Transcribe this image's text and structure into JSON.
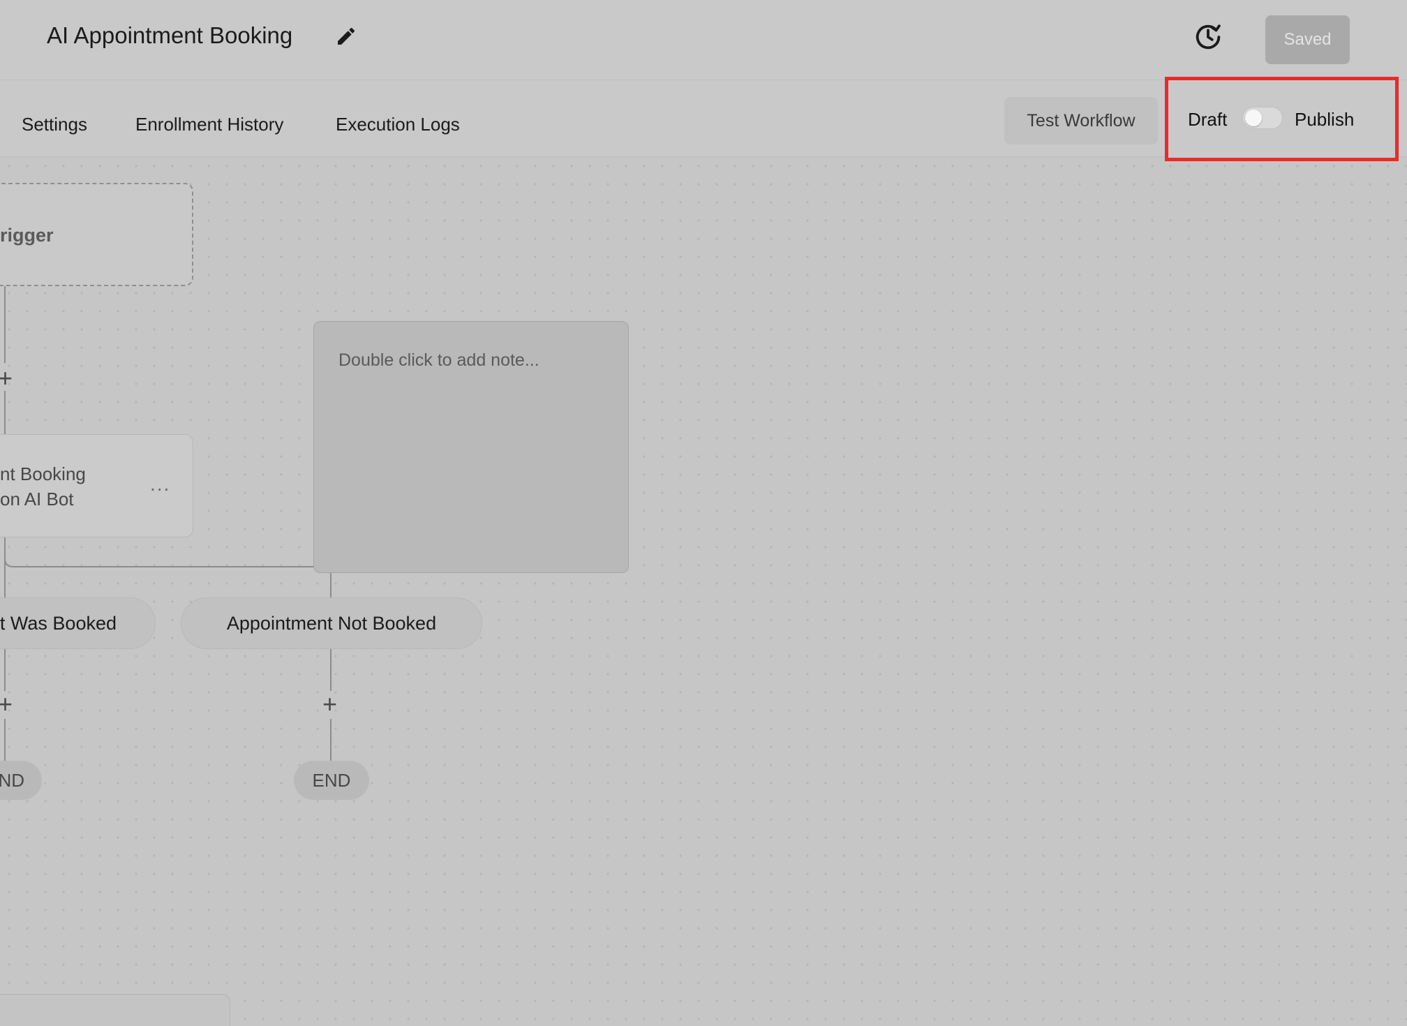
{
  "header": {
    "title": "AI Appointment Booking",
    "saved_label": "Saved"
  },
  "tabs": {
    "settings": "Settings",
    "enrollment_history": "Enrollment History",
    "execution_logs": "Execution Logs"
  },
  "actions": {
    "test_workflow": "Test Workflow",
    "draft_label": "Draft",
    "publish_label": "Publish",
    "publish_toggle_on": false
  },
  "canvas": {
    "trigger_label": "rigger",
    "action_line1": "nt Booking",
    "action_line2": "on AI Bot",
    "action_menu": "...",
    "note_placeholder": "Double click to add note...",
    "branch_booked": "t Was Booked",
    "branch_not_booked": "Appointment Not Booked",
    "end_left": "ND",
    "end_right": "END",
    "plus_symbol": "+"
  },
  "colors": {
    "highlight_border": "#ea2a2a",
    "canvas_bg": "#c6c6c6"
  }
}
